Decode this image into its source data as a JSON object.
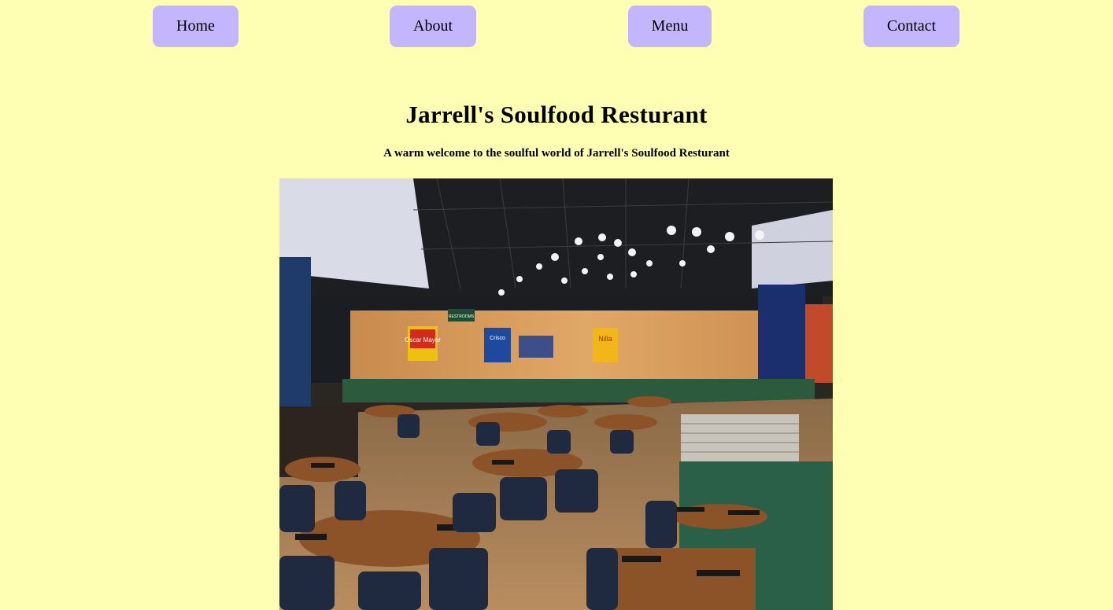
{
  "nav": {
    "items": [
      {
        "label": "Home"
      },
      {
        "label": "About"
      },
      {
        "label": "Menu"
      },
      {
        "label": "Contact"
      }
    ]
  },
  "hero": {
    "title": "Jarrell's Soulfood Resturant",
    "subtitle": "A warm welcome to the soulful world of Jarrell's Soulfood Resturant"
  },
  "photo": {
    "signs": [
      "Oscar Mayer",
      "Crisco",
      "Nilla",
      "RESTROOMS"
    ]
  },
  "colors": {
    "background": "#ffffb3",
    "nav_button": "#c4b5ff"
  }
}
